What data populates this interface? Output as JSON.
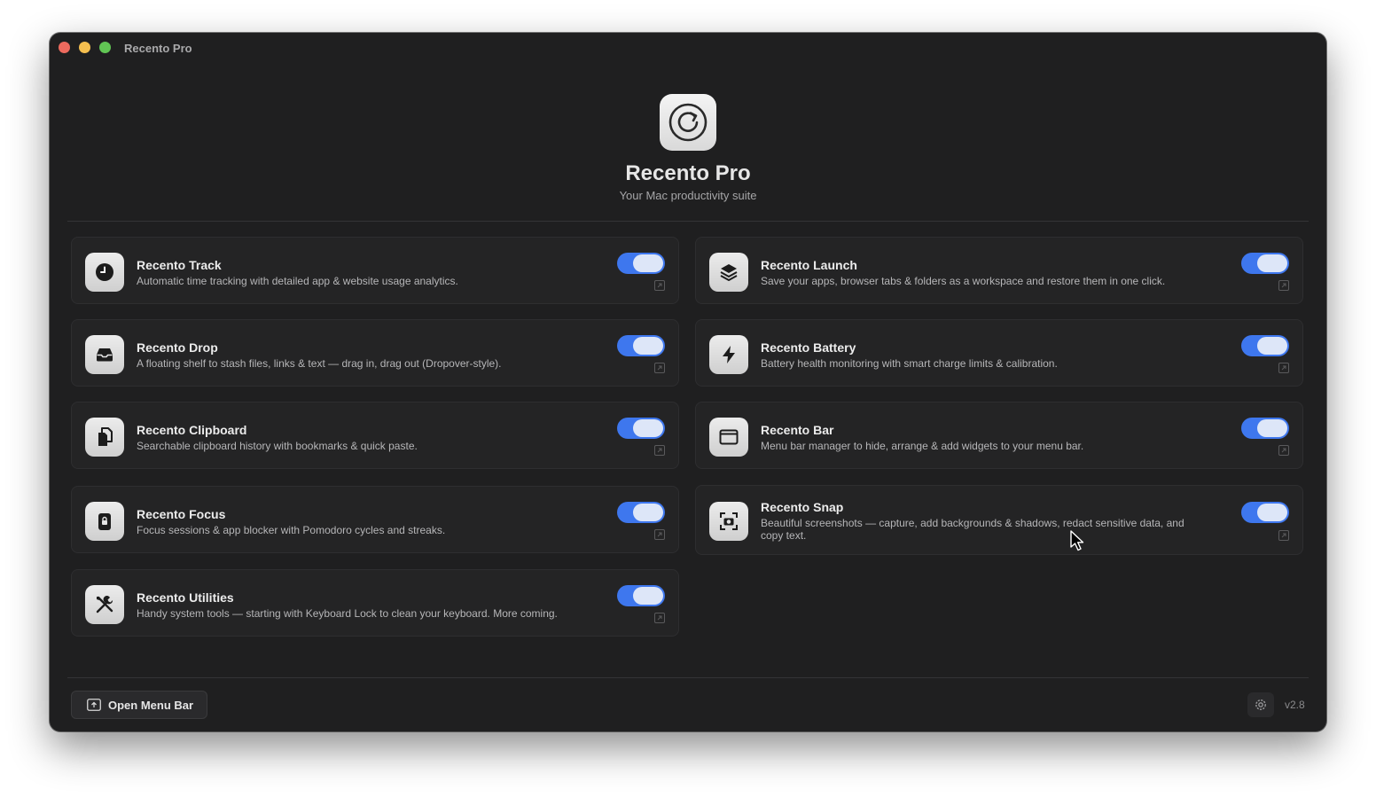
{
  "window": {
    "title": "Recento Pro"
  },
  "hero": {
    "title": "Recento Pro",
    "subtitle": "Your Mac productivity suite",
    "icon": "refresh-icon"
  },
  "modules": [
    {
      "title": "Recento Track",
      "description": "Automatic time tracking with detailed app & website usage analytics.",
      "icon": "clock-icon",
      "enabled": true
    },
    {
      "title": "Recento Launch",
      "description": "Save your apps, browser tabs & folders as a workspace and restore them in one click.",
      "icon": "layers-icon",
      "enabled": true
    },
    {
      "title": "Recento Drop",
      "description": "A floating shelf to stash files, links & text — drag in, drag out (Dropover-style).",
      "icon": "tray-icon",
      "enabled": true
    },
    {
      "title": "Recento Battery",
      "description": "Battery health monitoring with smart charge limits & calibration.",
      "icon": "bolt-icon",
      "enabled": true
    },
    {
      "title": "Recento Clipboard",
      "description": "Searchable clipboard history with bookmarks & quick paste.",
      "icon": "clipboard-icon",
      "enabled": true
    },
    {
      "title": "Recento Bar",
      "description": "Menu bar manager to hide, arrange & add widgets to your menu bar.",
      "icon": "window-icon",
      "enabled": true
    },
    {
      "title": "Recento Focus",
      "description": "Focus sessions & app blocker with Pomodoro cycles and streaks.",
      "icon": "lock-icon",
      "enabled": true
    },
    {
      "title": "Recento Snap",
      "description": "Beautiful screenshots — capture, add backgrounds & shadows, redact sensitive data, and copy text.",
      "icon": "camera-viewfinder-icon",
      "enabled": true
    },
    {
      "title": "Recento Utilities",
      "description": "Handy system tools — starting with Keyboard Lock to clean your keyboard. More coming.",
      "icon": "tools-icon",
      "enabled": true
    }
  ],
  "footer": {
    "open_menu_bar_label": "Open Menu Bar",
    "version": "v2.8"
  },
  "colors": {
    "accent": "#3e77ee",
    "background": "#1f1f20",
    "card": "#242425"
  }
}
